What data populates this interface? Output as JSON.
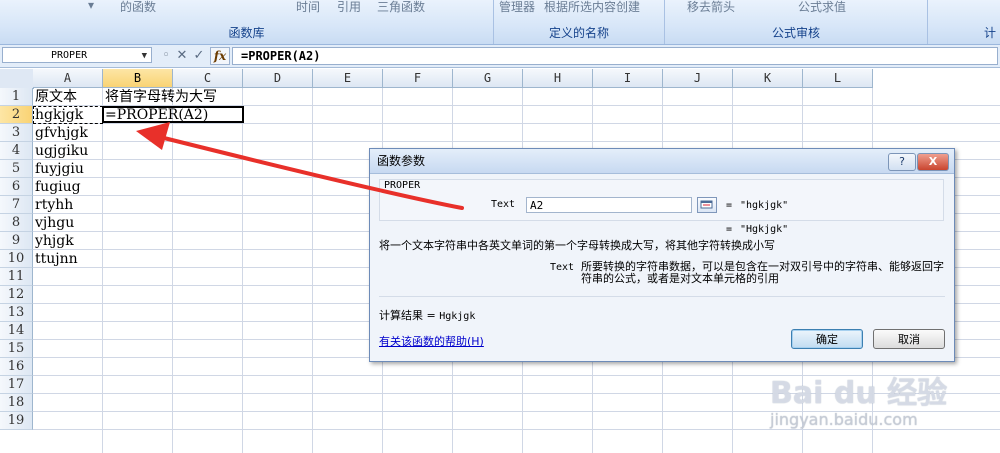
{
  "ribbon": {
    "items": [
      "的函数",
      "时间",
      "引用",
      "三角函数",
      "管理器",
      "根据所选内容创建",
      "移去箭头",
      "公式求值"
    ],
    "groups": [
      "函数库",
      "定义的名称",
      "公式审核",
      "计"
    ]
  },
  "formula_bar": {
    "name_box": "PROPER",
    "fx_label": "fx",
    "formula": "=PROPER(A2)"
  },
  "grid": {
    "columns": [
      "A",
      "B",
      "C",
      "D",
      "E",
      "F",
      "G",
      "H",
      "I",
      "J",
      "K",
      "L"
    ],
    "rows": [
      "1",
      "2",
      "3",
      "4",
      "5",
      "6",
      "7",
      "8",
      "9",
      "10",
      "11",
      "12",
      "13",
      "14",
      "15",
      "16",
      "17",
      "18",
      "19"
    ],
    "cells": {
      "A1": "原文本",
      "B1": "将首字母转为大写",
      "A2": "hgkjgk",
      "B2": "=PROPER(A2)",
      "A3": "gfvhjgk",
      "A4": "ugjgiku",
      "A5": "fuyjgiu",
      "A6": "fugiug",
      "A7": "rtyhh",
      "A8": "vjhgu",
      "A9": "yhjgk",
      "A10": "ttujnn"
    }
  },
  "dialog": {
    "title": "函数参数",
    "help_button": "?",
    "close_button": "X",
    "function_name": "PROPER",
    "arg_label": "Text",
    "arg_value": "A2",
    "arg_result": "\"hgkjgk\"",
    "result_preview": "\"Hgkjgk\"",
    "equals": "=",
    "description": "将一个文本字符串中各英文单词的第一个字母转换成大写，将其他字符转换成小写",
    "param_label": "Text",
    "param_description": "所要转换的字符串数据，可以是包含在一对双引号中的字符串、能够返回字符串的公式，或者是对文本单元格的引用",
    "calc_label": "计算结果 =",
    "calc_value": "Hgkjgk",
    "help_link": "有关该函数的帮助(H)",
    "ok_label": "确定",
    "cancel_label": "取消"
  },
  "watermark": {
    "logo": "Bai du 经验",
    "url": "jingyan.baidu.com"
  },
  "colors": {
    "ribbon_bg": "#d7e6f8",
    "header_selected": "#f9d374",
    "arrow": "#e8302a",
    "link": "#0000cc"
  }
}
